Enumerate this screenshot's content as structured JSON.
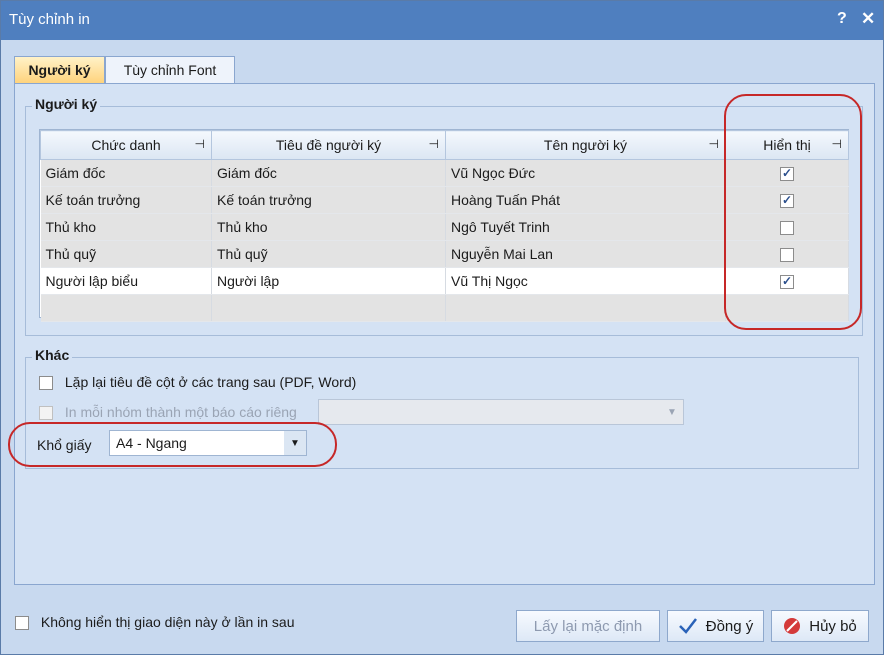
{
  "window": {
    "title": "Tùy chỉnh in",
    "help_label": "?",
    "close_label": "✕"
  },
  "tabs": [
    {
      "label": "Người ký",
      "active": true
    },
    {
      "label": "Tùy chỉnh Font",
      "active": false
    }
  ],
  "signers_group": {
    "title": "Người ký",
    "columns": [
      "Chức danh",
      "Tiêu đề người ký",
      "Tên người ký",
      "Hiển thị"
    ],
    "rows": [
      {
        "position": "Giám đốc",
        "signer_title": "Giám đốc",
        "name": "Vũ Ngọc Đức",
        "show": true
      },
      {
        "position": "Kế toán trưởng",
        "signer_title": "Kế toán trưởng",
        "name": "Hoàng Tuấn Phát",
        "show": true
      },
      {
        "position": "Thủ kho",
        "signer_title": "Thủ kho",
        "name": "Ngô Tuyết Trinh",
        "show": false
      },
      {
        "position": "Thủ quỹ",
        "signer_title": "Thủ quỹ",
        "name": "Nguyễn Mai Lan",
        "show": false
      },
      {
        "position": "Người lập biểu",
        "signer_title": "Người lập",
        "name": "Vũ Thị Ngọc",
        "show": true
      }
    ]
  },
  "other_group": {
    "title": "Khác",
    "repeat_header_label": "Lặp lại tiêu đề cột ở các trang sau (PDF, Word)",
    "repeat_header_checked": false,
    "separate_report_label": "In mỗi nhóm thành một báo cáo riêng",
    "separate_report_checked": false,
    "separate_report_value": "",
    "paper_size_label": "Khổ giấy",
    "paper_size_value": "A4 - Ngang"
  },
  "footer": {
    "dont_show_label": "Không hiển thị giao diện này ở lần in sau",
    "dont_show_checked": false,
    "reset_button": "Lấy lại mặc định",
    "ok_button": "Đồng ý",
    "cancel_button": "Hủy bỏ"
  },
  "colors": {
    "titlebar": "#4f7fbf",
    "annotation": "#c62828",
    "ok_check": "#2a62b8",
    "cancel_icon": "#d43a3a"
  }
}
